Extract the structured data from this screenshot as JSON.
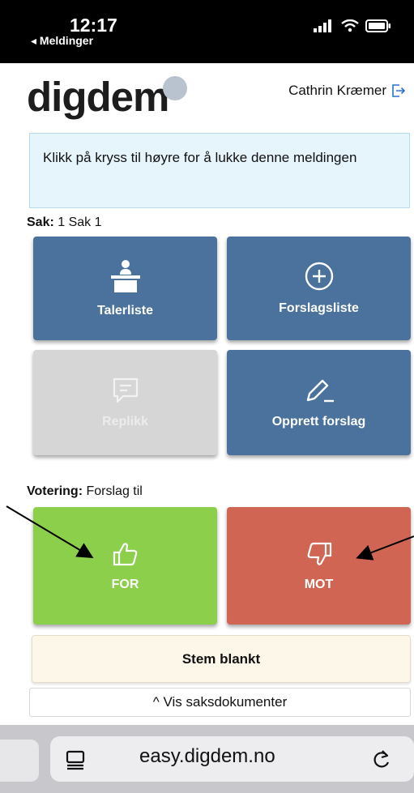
{
  "status_bar": {
    "time": "12:17",
    "back_label": "◂ Meldinger"
  },
  "header": {
    "logo": "digdem",
    "user_name": "Cathrin Kræmer"
  },
  "notice": {
    "text": "Klikk på kryss til høyre for å lukke denne meldingen"
  },
  "case": {
    "label": "Sak:",
    "value": "1 Sak 1"
  },
  "tiles": {
    "speakers": "Talerliste",
    "proposals": "Forslagsliste",
    "reply": "Replikk",
    "create_proposal": "Opprett forslag"
  },
  "voting": {
    "label": "Votering:",
    "value": "Forslag til",
    "for_label": "FOR",
    "against_label": "MOT",
    "blank_label": "Stem blankt"
  },
  "documents_toggle": "^ Vis saksdokumenter",
  "browser": {
    "url": "easy.digdem.no"
  },
  "colors": {
    "tile_blue": "#4a729c",
    "for_green": "#8ccf4a",
    "against_red": "#cf6552",
    "disabled_gray": "#d6d6d6"
  }
}
